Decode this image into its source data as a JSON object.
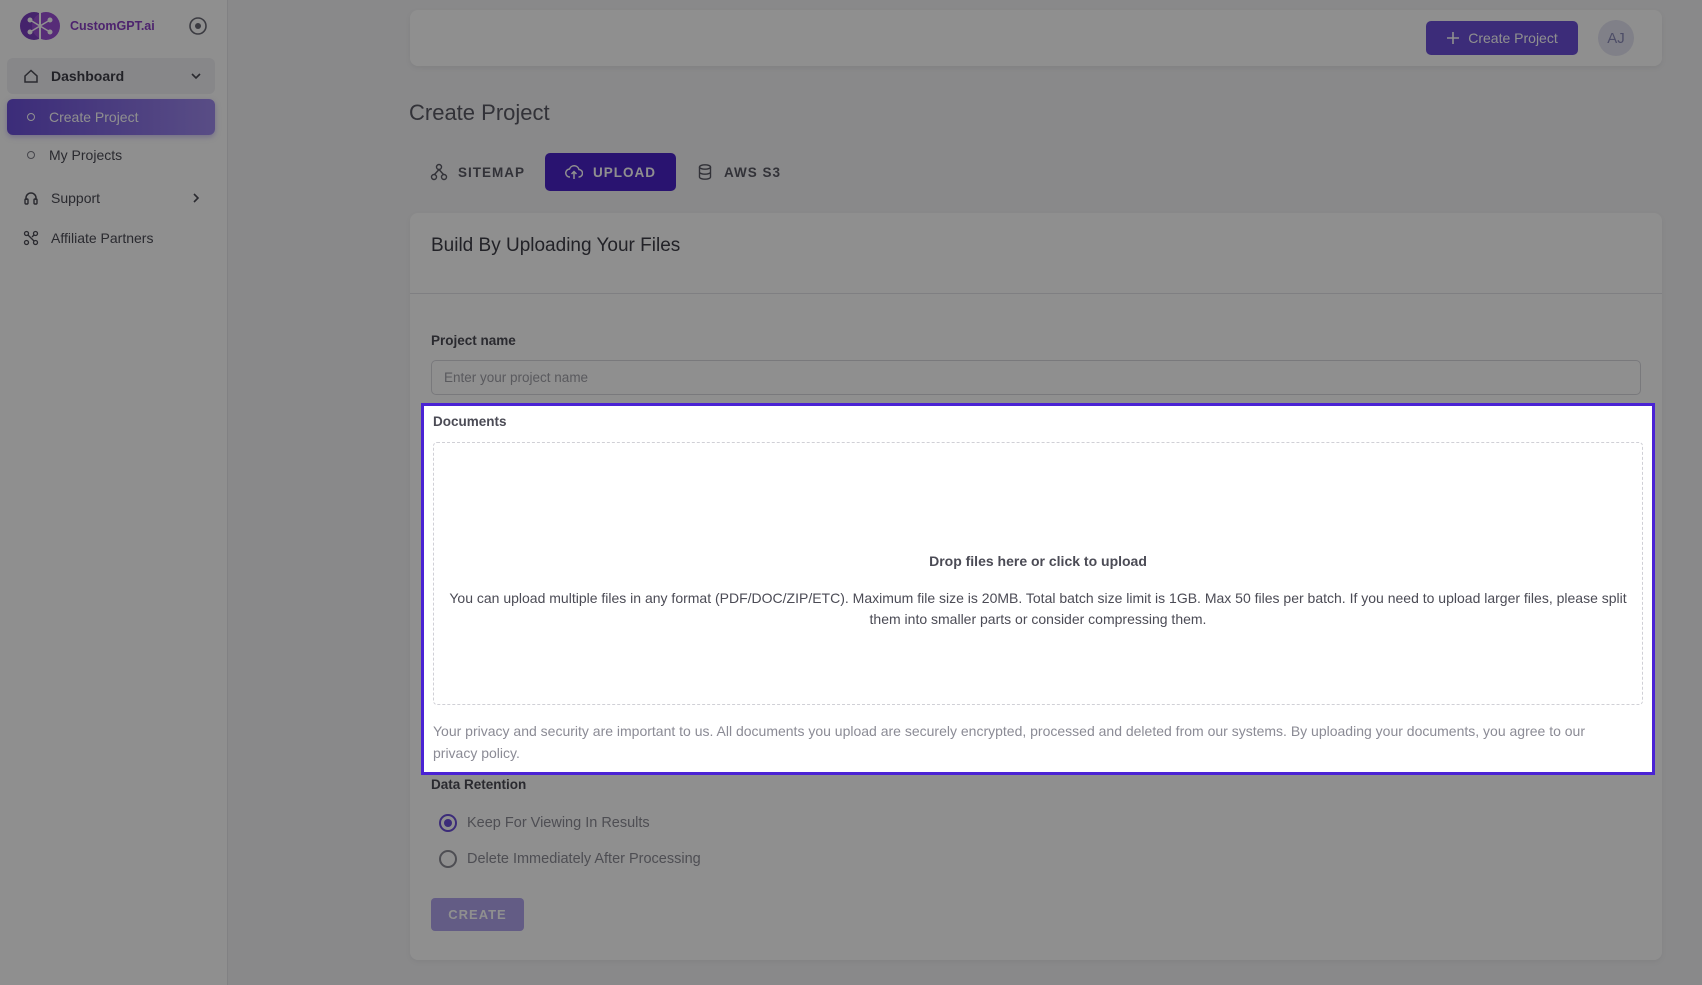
{
  "brand": {
    "name": "CustomGPT.ai"
  },
  "sidebar": {
    "items": [
      {
        "label": "Dashboard"
      },
      {
        "label": "Create Project"
      },
      {
        "label": "My Projects"
      },
      {
        "label": "Support"
      },
      {
        "label": "Affiliate Partners"
      }
    ]
  },
  "header": {
    "create_label": "Create Project",
    "avatar_initials": "AJ"
  },
  "page": {
    "title": "Create Project"
  },
  "tabs": [
    {
      "label": "SITEMAP"
    },
    {
      "label": "UPLOAD"
    },
    {
      "label": "AWS S3"
    }
  ],
  "card": {
    "title": "Build By Uploading Your Files",
    "project_label": "Project name",
    "project_placeholder": "Enter your project name",
    "documents_label": "Documents",
    "drop_title": "Drop files here or click to upload",
    "drop_desc": "You can upload multiple files in any format (PDF/DOC/ZIP/ETC). Maximum file size is 20MB. Total batch size limit is 1GB. Max 50 files per batch. If you need to upload larger files, please split them into smaller parts or consider compressing them.",
    "privacy": "Your privacy and security are important to us. All documents you upload are securely encrypted, processed and deleted from our systems. By uploading your documents, you agree to our privacy policy.",
    "retention_label": "Data Retention",
    "retention_options": [
      {
        "label": "Keep For Viewing In Results",
        "selected": true
      },
      {
        "label": "Delete Immediately After Processing",
        "selected": false
      }
    ],
    "create_label": "CREATE"
  },
  "colors": {
    "accent": "#6b4fd8",
    "tab_active": "#4a22c8",
    "highlight_border": "#4a22d4"
  }
}
